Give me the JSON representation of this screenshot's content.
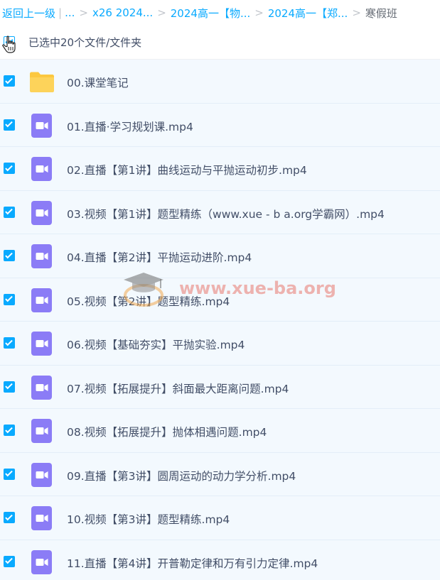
{
  "breadcrumb": {
    "back": "返回上一级",
    "ellipsis": "...",
    "crumbs": [
      "x26 2024...",
      "2024高一【物...",
      "2024高一【郑..."
    ],
    "current": "寒假班"
  },
  "selection": {
    "summary": "已选中20个文件/文件夹"
  },
  "files": [
    {
      "name": "00.课堂笔记",
      "type": "folder",
      "icon": "folder-icon"
    },
    {
      "name": "01.直播·学习规划课.mp4",
      "type": "video",
      "icon": "video-file-icon"
    },
    {
      "name": "02.直播【第1讲】曲线运动与平抛运动初步.mp4",
      "type": "video",
      "icon": "video-file-icon"
    },
    {
      "name": "03.视频【第1讲】题型精练（www.xue - b a.org学霸网）.mp4",
      "type": "video",
      "icon": "video-file-icon"
    },
    {
      "name": "04.直播【第2讲】平抛运动进阶.mp4",
      "type": "video",
      "icon": "video-file-icon"
    },
    {
      "name": "05.视频【第2讲】题型精练.mp4",
      "type": "video",
      "icon": "video-file-icon"
    },
    {
      "name": "06.视频【基础夯实】平抛实验.mp4",
      "type": "video",
      "icon": "video-file-icon"
    },
    {
      "name": "07.视频【拓展提升】斜面最大距离问题.mp4",
      "type": "video",
      "icon": "video-file-icon"
    },
    {
      "name": "08.视频【拓展提升】抛体相遇问题.mp4",
      "type": "video",
      "icon": "video-file-icon"
    },
    {
      "name": "09.直播【第3讲】圆周运动的动力学分析.mp4",
      "type": "video",
      "icon": "video-file-icon"
    },
    {
      "name": "10.视频【第3讲】题型精练.mp4",
      "type": "video",
      "icon": "video-file-icon"
    },
    {
      "name": "11.直播【第4讲】开普勒定律和万有引力定律.mp4",
      "type": "video",
      "icon": "video-file-icon"
    }
  ],
  "watermark": {
    "text": "www.xue-ba.org"
  },
  "colors": {
    "accent": "#09aaff",
    "row_bg": "#f3f9fe",
    "video_icon": "#8b7cf6",
    "folder_icon": "#fcc83f"
  }
}
